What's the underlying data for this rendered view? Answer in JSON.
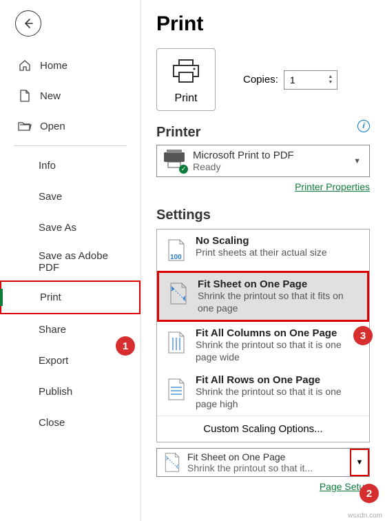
{
  "title": "Print",
  "sidebar": {
    "primary": [
      {
        "icon": "home",
        "label": "Home"
      },
      {
        "icon": "new",
        "label": "New"
      },
      {
        "icon": "open",
        "label": "Open"
      }
    ],
    "secondary": [
      "Info",
      "Save",
      "Save As",
      "Save as Adobe PDF",
      "Print",
      "Share",
      "Export",
      "Publish",
      "Close"
    ]
  },
  "print_button": "Print",
  "copies": {
    "label": "Copies:",
    "value": "1"
  },
  "printer_heading": "Printer",
  "printer": {
    "name": "Microsoft Print to PDF",
    "status": "Ready"
  },
  "printer_props": "Printer Properties",
  "settings_heading": "Settings",
  "scaling_options": [
    {
      "title": "No Scaling",
      "desc": "Print sheets at their actual size"
    },
    {
      "title": "Fit Sheet on One Page",
      "desc": "Shrink the printout so that it fits on one page"
    },
    {
      "title": "Fit All Columns on One Page",
      "desc": "Shrink the printout so that it is one page wide"
    },
    {
      "title": "Fit All Rows on One Page",
      "desc": "Shrink the printout so that it is one page high"
    }
  ],
  "custom_scaling": "Custom Scaling Options...",
  "current_scaling": {
    "title": "Fit Sheet on One Page",
    "desc": "Shrink the printout so that it..."
  },
  "page_setup": "Page Setup",
  "badges": {
    "b1": "1",
    "b2": "2",
    "b3": "3"
  },
  "watermark": "wsxdn.com"
}
